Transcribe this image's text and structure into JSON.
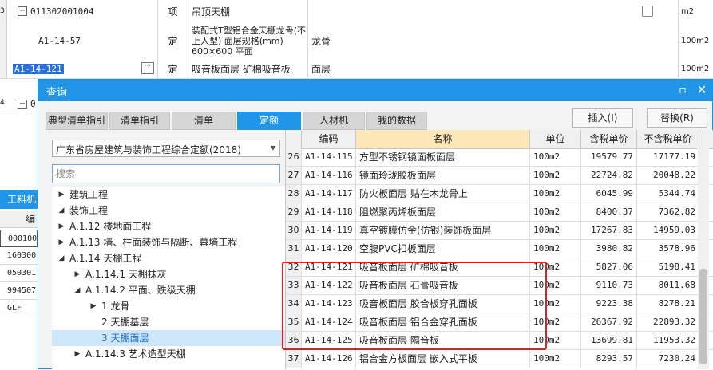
{
  "sheet": {
    "rows": [
      {
        "lead": "3",
        "code": "011302001004",
        "type": "项",
        "name": "吊顶天棚",
        "feature": "",
        "unit": "m2",
        "show_checkbox": true
      },
      {
        "lead": "",
        "code": "A1-14-57",
        "type": "定",
        "name": "装配式T型铝合金天棚龙骨(不上人型) 面层规格(mm) 600×600 平面",
        "feature": "龙骨",
        "unit": "100m2",
        "show_checkbox": false
      },
      {
        "lead": "",
        "code": "A1-14-121",
        "type": "定",
        "name": "吸音板面层 矿棉吸音板",
        "feature": "面层",
        "unit": "100m2",
        "show_checkbox": false
      }
    ],
    "fragment_row_lead": "4",
    "fragment_row_code": "0",
    "material_panel_label": "工料机",
    "material_col_header": "编",
    "material_codes": [
      "000100",
      "160300",
      "050301",
      "994507",
      "GLF"
    ]
  },
  "dialog": {
    "title": "查询",
    "minimize_label": "▫",
    "close_label": "✕",
    "tabs": [
      "典型清单指引",
      "清单指引",
      "清单",
      "定额",
      "人材机",
      "我的数据"
    ],
    "active_tab": "定额",
    "insert_label": "插入(I)",
    "replace_label": "替换(R)",
    "library": "广东省房屋建筑与装饰工程综合定额(2018)",
    "search_placeholder": "搜索",
    "tree": [
      {
        "label": "建筑工程",
        "level": 0,
        "expanded": false,
        "selected": false
      },
      {
        "label": "装饰工程",
        "level": 0,
        "expanded": true,
        "selected": false
      },
      {
        "label": "A.1.12 楼地面工程",
        "level": 1,
        "expanded": false,
        "selected": false
      },
      {
        "label": "A.1.13 墙、柱面装饰与隔断、幕墙工程",
        "level": 1,
        "expanded": false,
        "selected": false
      },
      {
        "label": "A.1.14 天棚工程",
        "level": 1,
        "expanded": true,
        "selected": false
      },
      {
        "label": "A.1.14.1 天棚抹灰",
        "level": 2,
        "expanded": false,
        "selected": false
      },
      {
        "label": "A.1.14.2 平面、跌级天棚",
        "level": 2,
        "expanded": true,
        "selected": false
      },
      {
        "label": "1 龙骨",
        "level": 3,
        "expanded": false,
        "selected": false
      },
      {
        "label": "2 天棚基层",
        "level": 3,
        "leaf": true,
        "selected": false
      },
      {
        "label": "3 天棚面层",
        "level": 3,
        "leaf": true,
        "selected": true
      },
      {
        "label": "A.1.14.3 艺术造型天棚",
        "level": 2,
        "expanded": false,
        "selected": false
      }
    ],
    "grid": {
      "headers": [
        "",
        "编码",
        "名称",
        "单位",
        "含税单价",
        "不含税单价"
      ],
      "rows": [
        {
          "n": "26",
          "code": "A1-14-115",
          "name": "方型不锈钢镜面板面层",
          "unit": "100m2",
          "tax": "19579.77",
          "notax": "17177.19"
        },
        {
          "n": "27",
          "code": "A1-14-116",
          "name": "镜面玲珑胶板面层",
          "unit": "100m2",
          "tax": "22724.82",
          "notax": "20048.22"
        },
        {
          "n": "28",
          "code": "A1-14-117",
          "name": "防火板面层 贴在木龙骨上",
          "unit": "100m2",
          "tax": "6045.99",
          "notax": "5344.74"
        },
        {
          "n": "29",
          "code": "A1-14-118",
          "name": "阻燃聚丙烯板面层",
          "unit": "100m2",
          "tax": "8400.37",
          "notax": "7362.82"
        },
        {
          "n": "30",
          "code": "A1-14-119",
          "name": "真空镀膜仿金(仿银)装饰板面层",
          "unit": "100m2",
          "tax": "17267.83",
          "notax": "14959.03"
        },
        {
          "n": "31",
          "code": "A1-14-120",
          "name": "空腹PVC扣板面层",
          "unit": "100m2",
          "tax": "3980.82",
          "notax": "3578.96"
        },
        {
          "n": "32",
          "code": "A1-14-121",
          "name": "吸音板面层 矿棉吸音板",
          "unit": "100m2",
          "tax": "5827.06",
          "notax": "5198.41"
        },
        {
          "n": "33",
          "code": "A1-14-122",
          "name": "吸音板面层 石膏吸音板",
          "unit": "100m2",
          "tax": "9110.73",
          "notax": "8011.68"
        },
        {
          "n": "34",
          "code": "A1-14-123",
          "name": "吸音板面层 胶合板穿孔面板",
          "unit": "100m2",
          "tax": "9223.38",
          "notax": "8278.21"
        },
        {
          "n": "35",
          "code": "A1-14-124",
          "name": "吸音板面层 铝合金穿孔面板",
          "unit": "100m2",
          "tax": "26367.92",
          "notax": "22893.32"
        },
        {
          "n": "36",
          "code": "A1-14-125",
          "name": "吸音板面层 隔音板",
          "unit": "100m2",
          "tax": "13699.81",
          "notax": "11953.32"
        },
        {
          "n": "37",
          "code": "A1-14-126",
          "name": "铝合金方板面层 嵌入式平板",
          "unit": "100m2",
          "tax": "8293.57",
          "notax": "7230.24"
        }
      ]
    }
  },
  "colors": {
    "accent": "#2196e8",
    "highlight_header": "#fce7b8",
    "selection": "#cde6fa",
    "annotation": "#e02020"
  }
}
